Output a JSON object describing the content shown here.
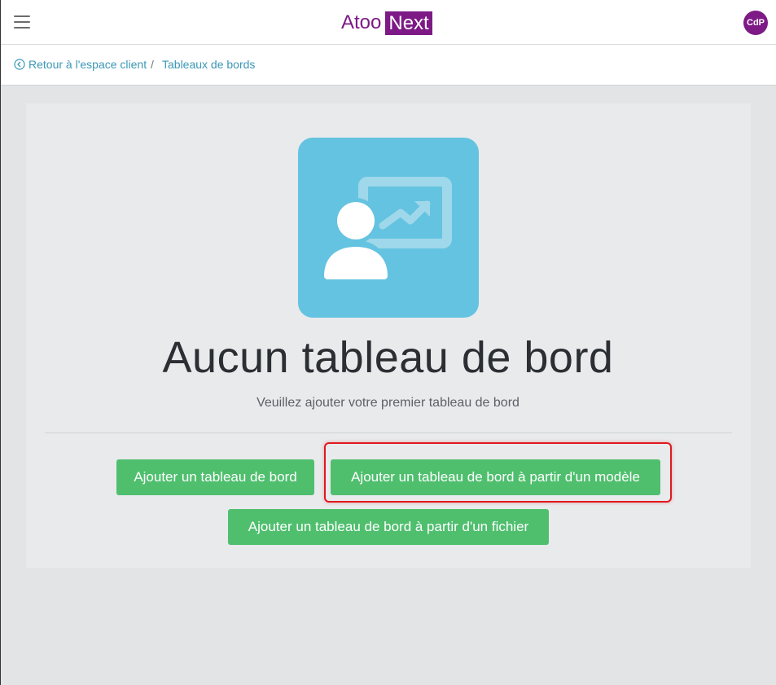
{
  "header": {
    "logo_part1": "Atoo",
    "logo_part2": "Next",
    "avatar_initials": "CdP"
  },
  "breadcrumb": {
    "back_label": "Retour à l'espace client",
    "separator": "/",
    "current": "Tableaux de bords"
  },
  "empty_state": {
    "title": "Aucun tableau de bord",
    "subtitle": "Veuillez ajouter votre premier tableau de bord",
    "icon": "presentation-chart-icon"
  },
  "actions": {
    "add_dashboard": "Ajouter un tableau de bord",
    "add_from_template": "Ajouter un tableau de bord à partir d'un modèle",
    "add_from_file": "Ajouter un tableau de bord à partir d'un fichier"
  },
  "colors": {
    "brand": "#7d1a86",
    "link": "#3b97b6",
    "button_green": "#4fbf6e",
    "icon_bg": "#64c3e0",
    "highlight": "#e0191e"
  }
}
